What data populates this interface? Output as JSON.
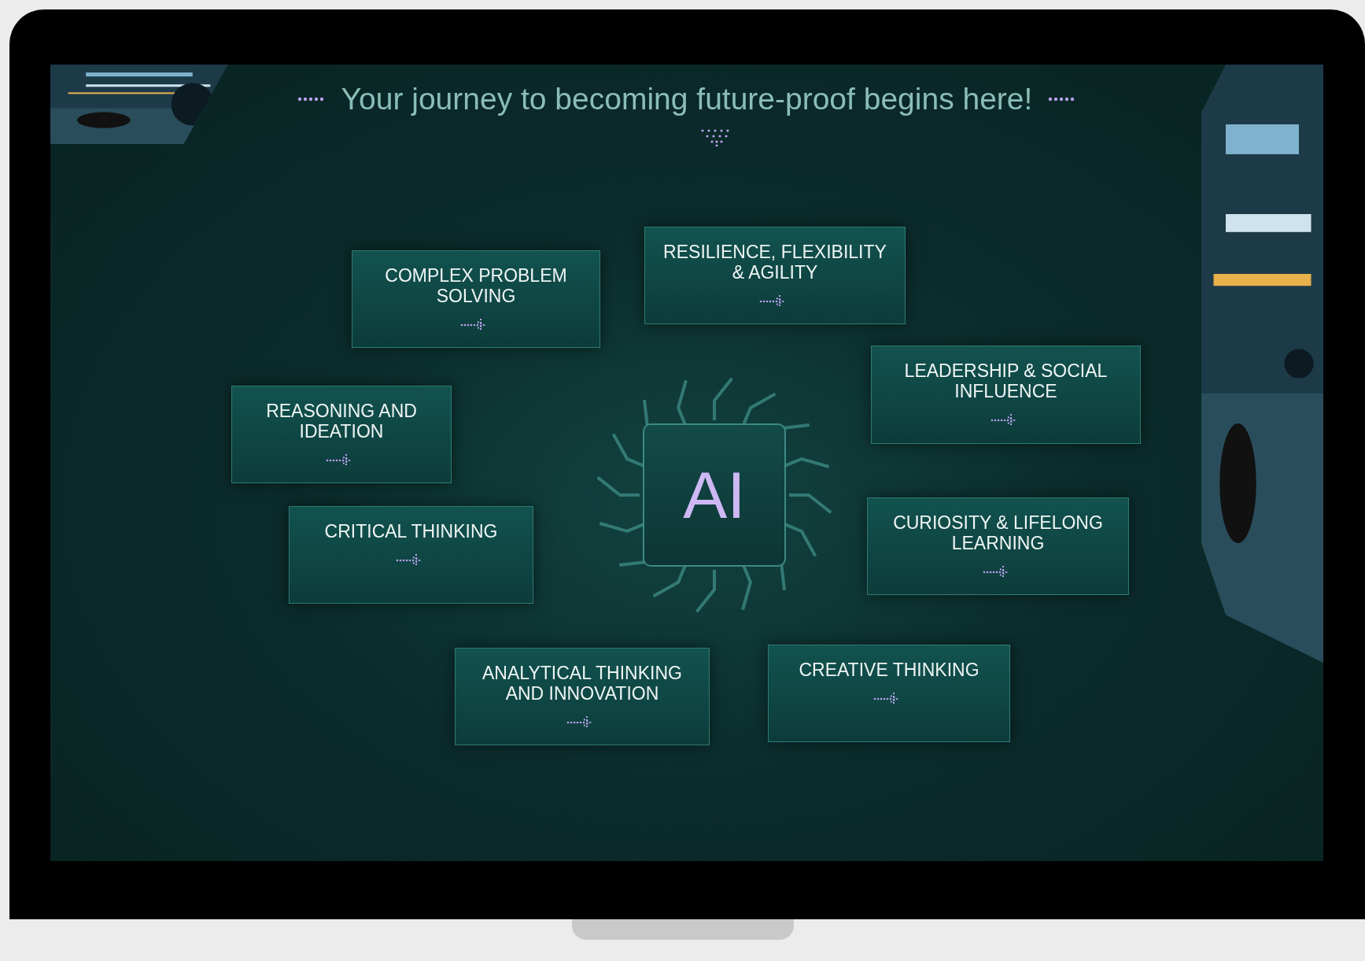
{
  "slide": {
    "title": "Your journey to becoming future-proof begins here!",
    "center_label": "AI",
    "nodes": [
      {
        "label": "COMPLEX PROBLEM SOLVING"
      },
      {
        "label": "RESILIENCE, FLEXIBILITY & AGILITY"
      },
      {
        "label": "LEADERSHIP & SOCIAL INFLUENCE"
      },
      {
        "label": "REASONING AND IDEATION"
      },
      {
        "label": "CRITICAL THINKING"
      },
      {
        "label": "CURIOSITY & LIFELONG LEARNING"
      },
      {
        "label": "ANALYTICAL THINKING AND INNOVATION"
      },
      {
        "label": "CREATIVE THINKING"
      }
    ]
  }
}
